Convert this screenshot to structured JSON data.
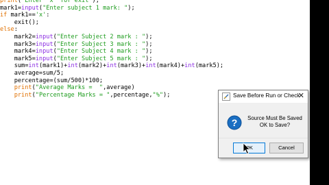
{
  "editor": {
    "lines": [
      [
        {
          "t": "print",
          "c": "kw"
        },
        {
          "t": "(",
          "c": ""
        },
        {
          "t": "\"Enter 'x' for exit\"",
          "c": "st"
        },
        {
          "t": ");",
          "c": ""
        }
      ],
      [
        {
          "t": "mark1=",
          "c": ""
        },
        {
          "t": "input",
          "c": "bi"
        },
        {
          "t": "(",
          "c": ""
        },
        {
          "t": "\"Enter subject 1 mark: \"",
          "c": "st"
        },
        {
          "t": ");",
          "c": ""
        }
      ],
      [
        {
          "t": "if",
          "c": "kw"
        },
        {
          "t": " mark1==",
          "c": ""
        },
        {
          "t": "'x'",
          "c": "st"
        },
        {
          "t": ":",
          "c": ""
        }
      ],
      [
        {
          "t": "    exit",
          "c": ""
        },
        {
          "t": "();",
          "c": ""
        }
      ],
      [
        {
          "t": "else",
          "c": "kw"
        },
        {
          "t": ":",
          "c": ""
        }
      ],
      [
        {
          "t": "    mark2=",
          "c": ""
        },
        {
          "t": "input",
          "c": "bi"
        },
        {
          "t": "(",
          "c": ""
        },
        {
          "t": "\"Enter Subject 2 mark : \"",
          "c": "st"
        },
        {
          "t": ");",
          "c": ""
        }
      ],
      [
        {
          "t": "    mark3=",
          "c": ""
        },
        {
          "t": "input",
          "c": "bi"
        },
        {
          "t": "(",
          "c": ""
        },
        {
          "t": "\"Enter Subject 3 mark : \"",
          "c": "st"
        },
        {
          "t": ");",
          "c": ""
        }
      ],
      [
        {
          "t": "    mark4=",
          "c": ""
        },
        {
          "t": "input",
          "c": "bi"
        },
        {
          "t": "(",
          "c": ""
        },
        {
          "t": "\"Enter Subject 4 mark : \"",
          "c": "st"
        },
        {
          "t": ");",
          "c": ""
        }
      ],
      [
        {
          "t": "    mark5=",
          "c": ""
        },
        {
          "t": "input",
          "c": "bi"
        },
        {
          "t": "(",
          "c": ""
        },
        {
          "t": "\"Enter Subject 5 mark : \"",
          "c": "st"
        },
        {
          "t": ");",
          "c": ""
        }
      ],
      [
        {
          "t": "    sum=",
          "c": ""
        },
        {
          "t": "int",
          "c": "bi"
        },
        {
          "t": "(mark1)+",
          "c": ""
        },
        {
          "t": "int",
          "c": "bi"
        },
        {
          "t": "(mark2)+",
          "c": ""
        },
        {
          "t": "int",
          "c": "bi"
        },
        {
          "t": "(mark3)+",
          "c": ""
        },
        {
          "t": "int",
          "c": "bi"
        },
        {
          "t": "(mark4)+",
          "c": ""
        },
        {
          "t": "int",
          "c": "bi"
        },
        {
          "t": "(mark5);",
          "c": ""
        }
      ],
      [
        {
          "t": "    average=sum/5;",
          "c": ""
        }
      ],
      [
        {
          "t": "    percentage=(sum/500)*100;",
          "c": ""
        }
      ],
      [
        {
          "t": "    ",
          "c": ""
        },
        {
          "t": "print",
          "c": "kw"
        },
        {
          "t": "(",
          "c": ""
        },
        {
          "t": "\"Average Marks =  \"",
          "c": "st"
        },
        {
          "t": ",average)",
          "c": ""
        }
      ],
      [
        {
          "t": "    ",
          "c": ""
        },
        {
          "t": "print",
          "c": "kw"
        },
        {
          "t": "(",
          "c": ""
        },
        {
          "t": "\"Percentage Marks = \"",
          "c": "st"
        },
        {
          "t": ",percentage,",
          "c": ""
        },
        {
          "t": "\"%\"",
          "c": "st"
        },
        {
          "t": ");",
          "c": ""
        }
      ]
    ]
  },
  "dialog": {
    "title": "Save Before Run or Check",
    "close_label": "✕",
    "message_line1": "Source Must Be Saved",
    "message_line2": "OK to Save?",
    "ok_label": "OK",
    "cancel_label": "Cancel"
  },
  "colors": {
    "keyword": "#e07000",
    "builtin": "#8a2be2",
    "string": "#1c9b1c",
    "ok_focus_border": "#0078d7"
  }
}
